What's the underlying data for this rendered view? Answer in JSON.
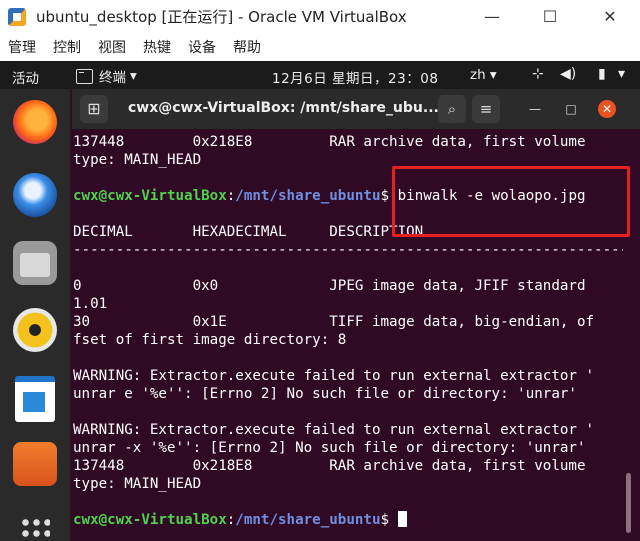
{
  "host_window": {
    "title": "ubuntu_desktop [正在运行] - Oracle VM VirtualBox",
    "controls": {
      "minimize": "—",
      "maximize": "☐",
      "close": "✕"
    },
    "menu": [
      "管理",
      "控制",
      "视图",
      "热键",
      "设备",
      "帮助"
    ]
  },
  "topbar": {
    "activities": "活动",
    "app": "终端",
    "app_arrow": "▾",
    "clock": "12月6日 星期日，23：08",
    "lang": "zh ▾",
    "tray": {
      "network": "⊹",
      "volume": "◀)",
      "battery": "▮",
      "menu": "▾"
    }
  },
  "dock": [
    "firefox",
    "thunderbird",
    "files",
    "rhythmbox",
    "libreoffice-writer",
    "ubuntu-software",
    "show-applications"
  ],
  "terminal": {
    "title": "cwx@cwx-VirtualBox: /mnt/share_ubu...",
    "buttons": {
      "new_tab": "⊞",
      "search": "⌕",
      "menu": "≡",
      "minimize": "—",
      "maximize": "□",
      "close": "✕"
    },
    "prompt_user": "cwx@cwx-VirtualBox",
    "prompt_sep": ":",
    "prompt_path": "/mnt/share_ubuntu",
    "prompt_end": "$ ",
    "command": "binwalk -e wolaopo.jpg",
    "lines_top": [
      "137448        0x218E8         RAR archive data, first volume",
      "type: MAIN_HEAD",
      ""
    ],
    "lines_output": [
      "",
      "DECIMAL       HEXADECIMAL     DESCRIPTION",
      "--------------------------------------------------------------------------------",
      "",
      "0             0x0             JPEG image data, JFIF standard",
      "1.01",
      "30            0x1E            TIFF image data, big-endian, of",
      "fset of first image directory: 8",
      "",
      "WARNING: Extractor.execute failed to run external extractor '",
      "unrar e '%e'': [Errno 2] No such file or directory: 'unrar'",
      "",
      "WARNING: Extractor.execute failed to run external extractor '",
      "unrar -x '%e'': [Errno 2] No such file or directory: 'unrar'",
      "137448        0x218E8         RAR archive data, first volume",
      "type: MAIN_HEAD",
      ""
    ]
  }
}
